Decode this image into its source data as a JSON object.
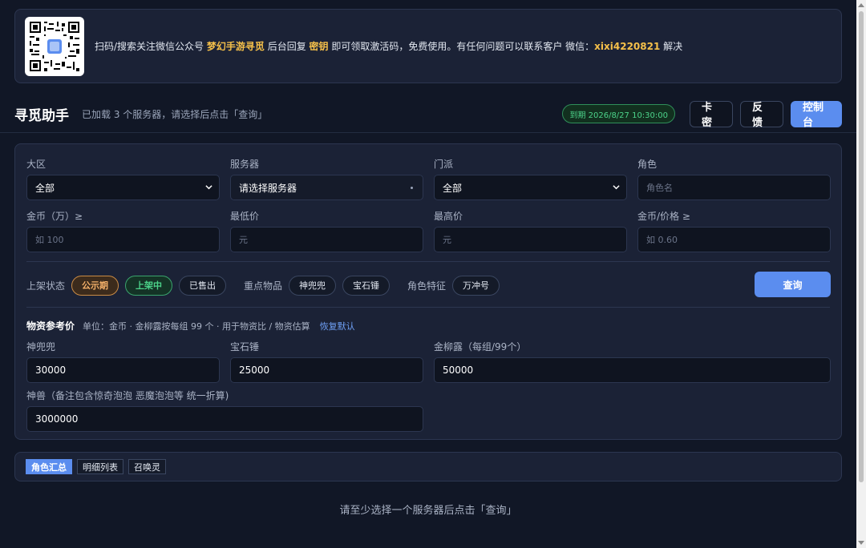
{
  "banner": {
    "text_pre": "扫码/搜索关注微信公众号 ",
    "account_name": "梦幻手游寻觅",
    "text_mid1": " 后台回复 ",
    "keyword": "密钥",
    "text_mid2": " 即可领取激活码，免费使用。有任何问题可以联系客户 微信：",
    "wechat_id": "xixi4220821",
    "text_post": " 解决"
  },
  "header": {
    "title": "寻觅助手",
    "subtitle": "已加载 3 个服务器，请选择后点击「查询」",
    "expiry": "到期 2026/8/27 10:30:00",
    "btn_card": "卡密",
    "btn_feedback": "反馈",
    "btn_console": "控制台"
  },
  "filters": {
    "region": {
      "label": "大区",
      "value": "全部"
    },
    "server": {
      "label": "服务器",
      "value": "请选择服务器"
    },
    "school": {
      "label": "门派",
      "value": "全部"
    },
    "role": {
      "label": "角色",
      "placeholder": "角色名"
    },
    "gold": {
      "label": "金币（万）≥",
      "placeholder": "如 100"
    },
    "min_price": {
      "label": "最低价",
      "placeholder": "元"
    },
    "max_price": {
      "label": "最高价",
      "placeholder": "元"
    },
    "gold_ratio": {
      "label": "金币/价格 ≥",
      "placeholder": "如 0.60"
    }
  },
  "chips": {
    "status_label": "上架状态",
    "status": [
      "公示期",
      "上架中",
      "已售出"
    ],
    "items_label": "重点物品",
    "items": [
      "神兜兜",
      "宝石锤"
    ],
    "feature_label": "角色特征",
    "features": [
      "万冲号"
    ],
    "query": "查询"
  },
  "reference": {
    "title": "物资参考价",
    "note": "单位：金币 · 金柳露按每组 99 个 · 用于物资比 / 物资估算",
    "reset": "恢复默认",
    "shendoudou": {
      "label": "神兜兜",
      "value": "30000"
    },
    "baoshichui": {
      "label": "宝石锤",
      "value": "25000"
    },
    "jinliulu": {
      "label": "金柳露（每组/99个）",
      "value": "50000"
    },
    "shenshou": {
      "label": "神兽（备注包含惊奇泡泡 恶魔泡泡等 统一折算)",
      "value": "3000000"
    }
  },
  "tabs": [
    "角色汇总",
    "明细列表",
    "召唤灵"
  ],
  "empty_message": "请至少选择一个服务器后点击「查询」"
}
